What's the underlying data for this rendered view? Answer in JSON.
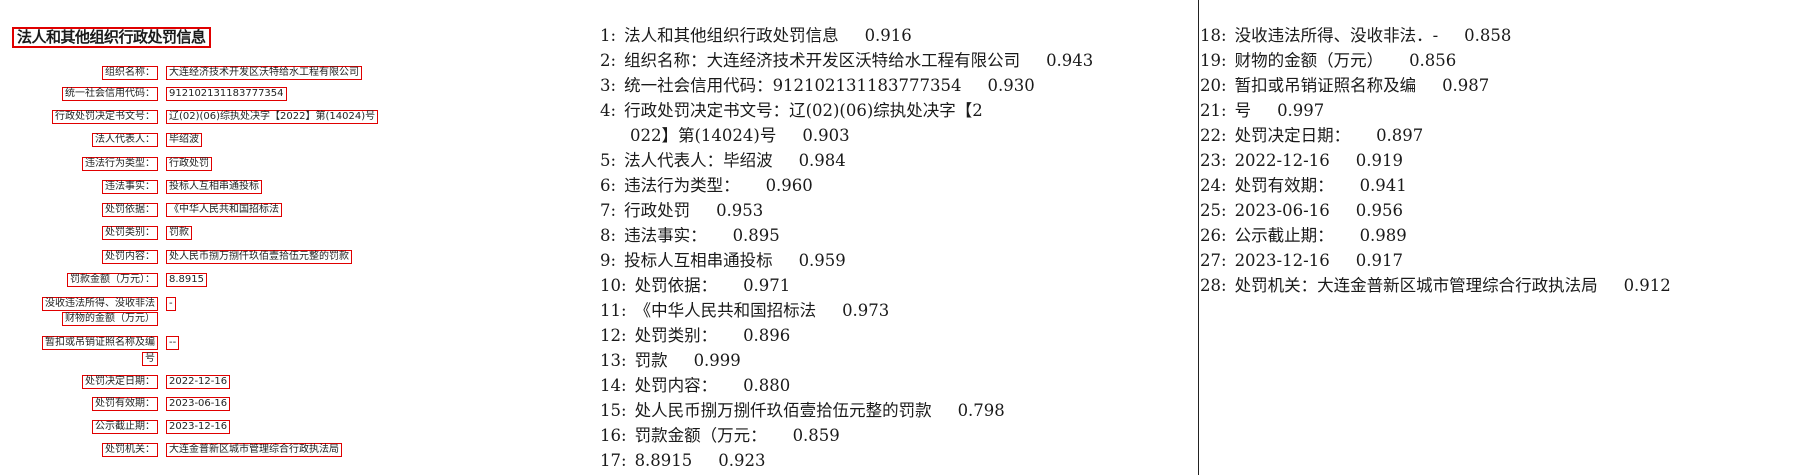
{
  "document": {
    "title": "法人和其他组织行政处罚信息",
    "fields": [
      {
        "label": "组织名称：",
        "value": "大连经济技术开发区沃特给水工程有限公司"
      },
      {
        "label": "统一社会信用代码：",
        "value": "912102131183777354"
      },
      {
        "label": "行政处罚决定书文号：",
        "value": "辽(02)(06)综执处决字【2022】第(14024)号"
      },
      {
        "label": "法人代表人：",
        "value": "毕绍波"
      },
      {
        "label": "违法行为类型：",
        "value": "行政处罚"
      },
      {
        "label": "违法事实：",
        "value": "投标人互相串通投标"
      },
      {
        "label": "处罚依据：",
        "value": "《中华人民共和国招标法"
      },
      {
        "label": "处罚类别：",
        "value": "罚款"
      },
      {
        "label": "处罚内容：",
        "value": "处人民币捌万捌仟玖佰壹拾伍元整的罚款"
      },
      {
        "label": "罚款金额（万元）：",
        "value": "8.8915"
      },
      {
        "label": "没收违法所得、没收非法",
        "value": "-"
      },
      {
        "label": "财物的金额（万元）",
        "value": ""
      },
      {
        "label": "暂扣或吊销证照名称及编",
        "value": "--"
      },
      {
        "label": "号",
        "value": ""
      },
      {
        "label": "处罚决定日期：",
        "value": "2022-12-16"
      },
      {
        "label": "处罚有效期：",
        "value": "2023-06-16"
      },
      {
        "label": "公示截止期：",
        "value": "2023-12-16"
      },
      {
        "label": "处罚机关：",
        "value": "大连金普新区城市管理综合行政执法局"
      }
    ]
  },
  "ocr_results": [
    {
      "idx": "1:",
      "text": "法人和其他组织行政处罚信息",
      "score": "0.916"
    },
    {
      "idx": "2:",
      "text": "组织名称：大连经济技术开发区沃特给水工程有限公司",
      "score": "0.943"
    },
    {
      "idx": "3:",
      "text": "统一社会信用代码：912102131183777354",
      "score": "0.930"
    },
    {
      "idx": "4:",
      "text": "行政处罚决定书文号：辽(02)(06)综执处决字【2",
      "score": ""
    },
    {
      "idx": "",
      "text": "022】第(14024)号",
      "score": "0.903"
    },
    {
      "idx": "5:",
      "text": "法人代表人：毕绍波",
      "score": "0.984"
    },
    {
      "idx": "6:",
      "text": "违法行为类型：",
      "score": "0.960"
    },
    {
      "idx": "7:",
      "text": "行政处罚",
      "score": "0.953"
    },
    {
      "idx": "8:",
      "text": "违法事实：",
      "score": "0.895"
    },
    {
      "idx": "9:",
      "text": "投标人互相串通投标",
      "score": "0.959"
    },
    {
      "idx": "10:",
      "text": "处罚依据：",
      "score": "0.971"
    },
    {
      "idx": "11:",
      "text": "《中华人民共和国招标法",
      "score": "0.973"
    },
    {
      "idx": "12:",
      "text": "处罚类别：",
      "score": "0.896"
    },
    {
      "idx": "13:",
      "text": "罚款",
      "score": "0.999"
    },
    {
      "idx": "14:",
      "text": "处罚内容：",
      "score": "0.880"
    },
    {
      "idx": "15:",
      "text": "处人民币捌万捌仟玖佰壹拾伍元整的罚款",
      "score": "0.798"
    },
    {
      "idx": "16:",
      "text": "罚款金额（万元：",
      "score": "0.859"
    },
    {
      "idx": "17:",
      "text": "8.8915",
      "score": "0.923"
    },
    {
      "idx": "18:",
      "text": "没收违法所得、没收非法．-",
      "score": "0.858"
    },
    {
      "idx": "19:",
      "text": "财物的金额（万元）",
      "score": "0.856"
    },
    {
      "idx": "20:",
      "text": "暂扣或吊销证照名称及编",
      "score": "0.987"
    },
    {
      "idx": "21:",
      "text": "号",
      "score": "0.997"
    },
    {
      "idx": "22:",
      "text": "处罚决定日期：",
      "score": "0.897"
    },
    {
      "idx": "23:",
      "text": "2022-12-16",
      "score": "0.919"
    },
    {
      "idx": "24:",
      "text": "处罚有效期：",
      "score": "0.941"
    },
    {
      "idx": "25:",
      "text": "2023-06-16",
      "score": "0.956"
    },
    {
      "idx": "26:",
      "text": "公示截止期：",
      "score": "0.989"
    },
    {
      "idx": "27:",
      "text": "2023-12-16",
      "score": "0.917"
    },
    {
      "idx": "28:",
      "text": "处罚机关：大连金普新区城市管理综合行政执法局",
      "score": "0.912"
    }
  ],
  "colors": {
    "box": "#e00000",
    "text": "#1a1a1a",
    "divider": "#222222"
  }
}
